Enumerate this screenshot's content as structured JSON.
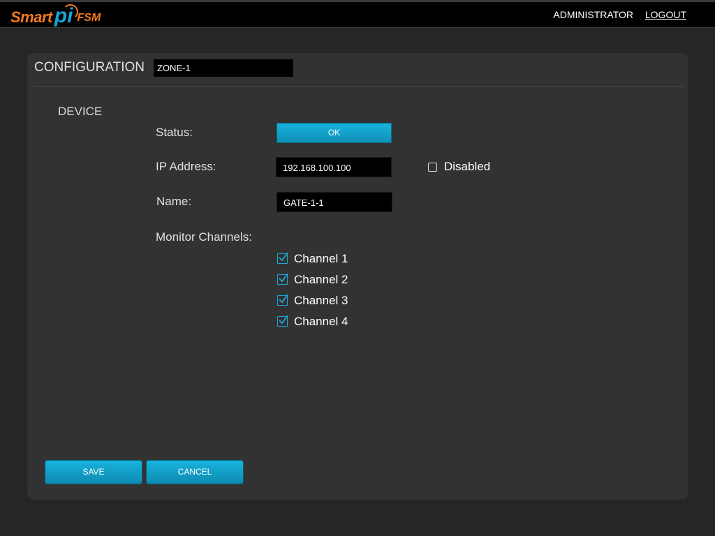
{
  "header": {
    "logo": {
      "part1": "Smart",
      "part2": "pi",
      "part3": "FSM"
    },
    "user_label": "ADMINISTRATOR",
    "logout_label": "LOGOUT"
  },
  "config": {
    "title": "CONFIGURATION",
    "zone_value": "ZONE-1"
  },
  "device": {
    "section_label": "DEVICE",
    "status_label": "Status:",
    "status_value": "OK",
    "ip_label": "IP Address:",
    "ip_value": "192.168.100.100",
    "disabled_label": "Disabled",
    "disabled_checked": false,
    "name_label": "Name:",
    "name_value": "GATE-1-1",
    "monitor_label": "Monitor Channels:",
    "channels": [
      {
        "label": "Channel 1",
        "checked": true
      },
      {
        "label": "Channel 2",
        "checked": true
      },
      {
        "label": "Channel 3",
        "checked": true
      },
      {
        "label": "Channel 4",
        "checked": true
      }
    ]
  },
  "actions": {
    "save_label": "SAVE",
    "cancel_label": "CANCEL"
  },
  "colors": {
    "accent": "#1aa3d6",
    "brand_orange": "#f07a20",
    "background": "#262626",
    "panel": "#323232"
  }
}
